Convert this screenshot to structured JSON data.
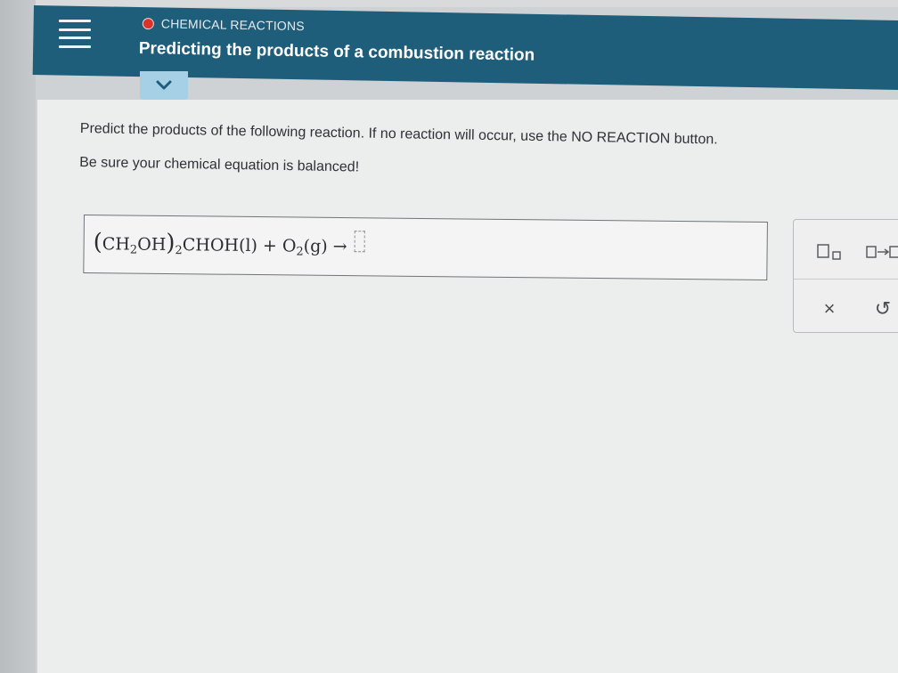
{
  "header": {
    "topic": "CHEMICAL REACTIONS",
    "title": "Predicting the products of a combustion reaction"
  },
  "instructions": {
    "line1": "Predict the products of the following reaction. If no reaction will occur, use the NO REACTION button.",
    "line2": "Be sure your chemical equation is balanced!"
  },
  "equation": {
    "open_paren": "(",
    "ch": "CH",
    "sub_2a": "2",
    "oh": "OH",
    "close_paren": ")",
    "sub_2b": "2",
    "choh": "CHOH",
    "state_l": "(l)",
    "plus": "+",
    "o": "O",
    "sub_2c": "2",
    "state_g": "(g)",
    "arrow": "→"
  },
  "toolbox": {
    "clear": "×",
    "undo": "↺"
  },
  "icons": [
    "menu-icon",
    "chevron-down-icon",
    "subscript-icon",
    "reaction-arrow-icon",
    "close-icon",
    "undo-icon"
  ]
}
